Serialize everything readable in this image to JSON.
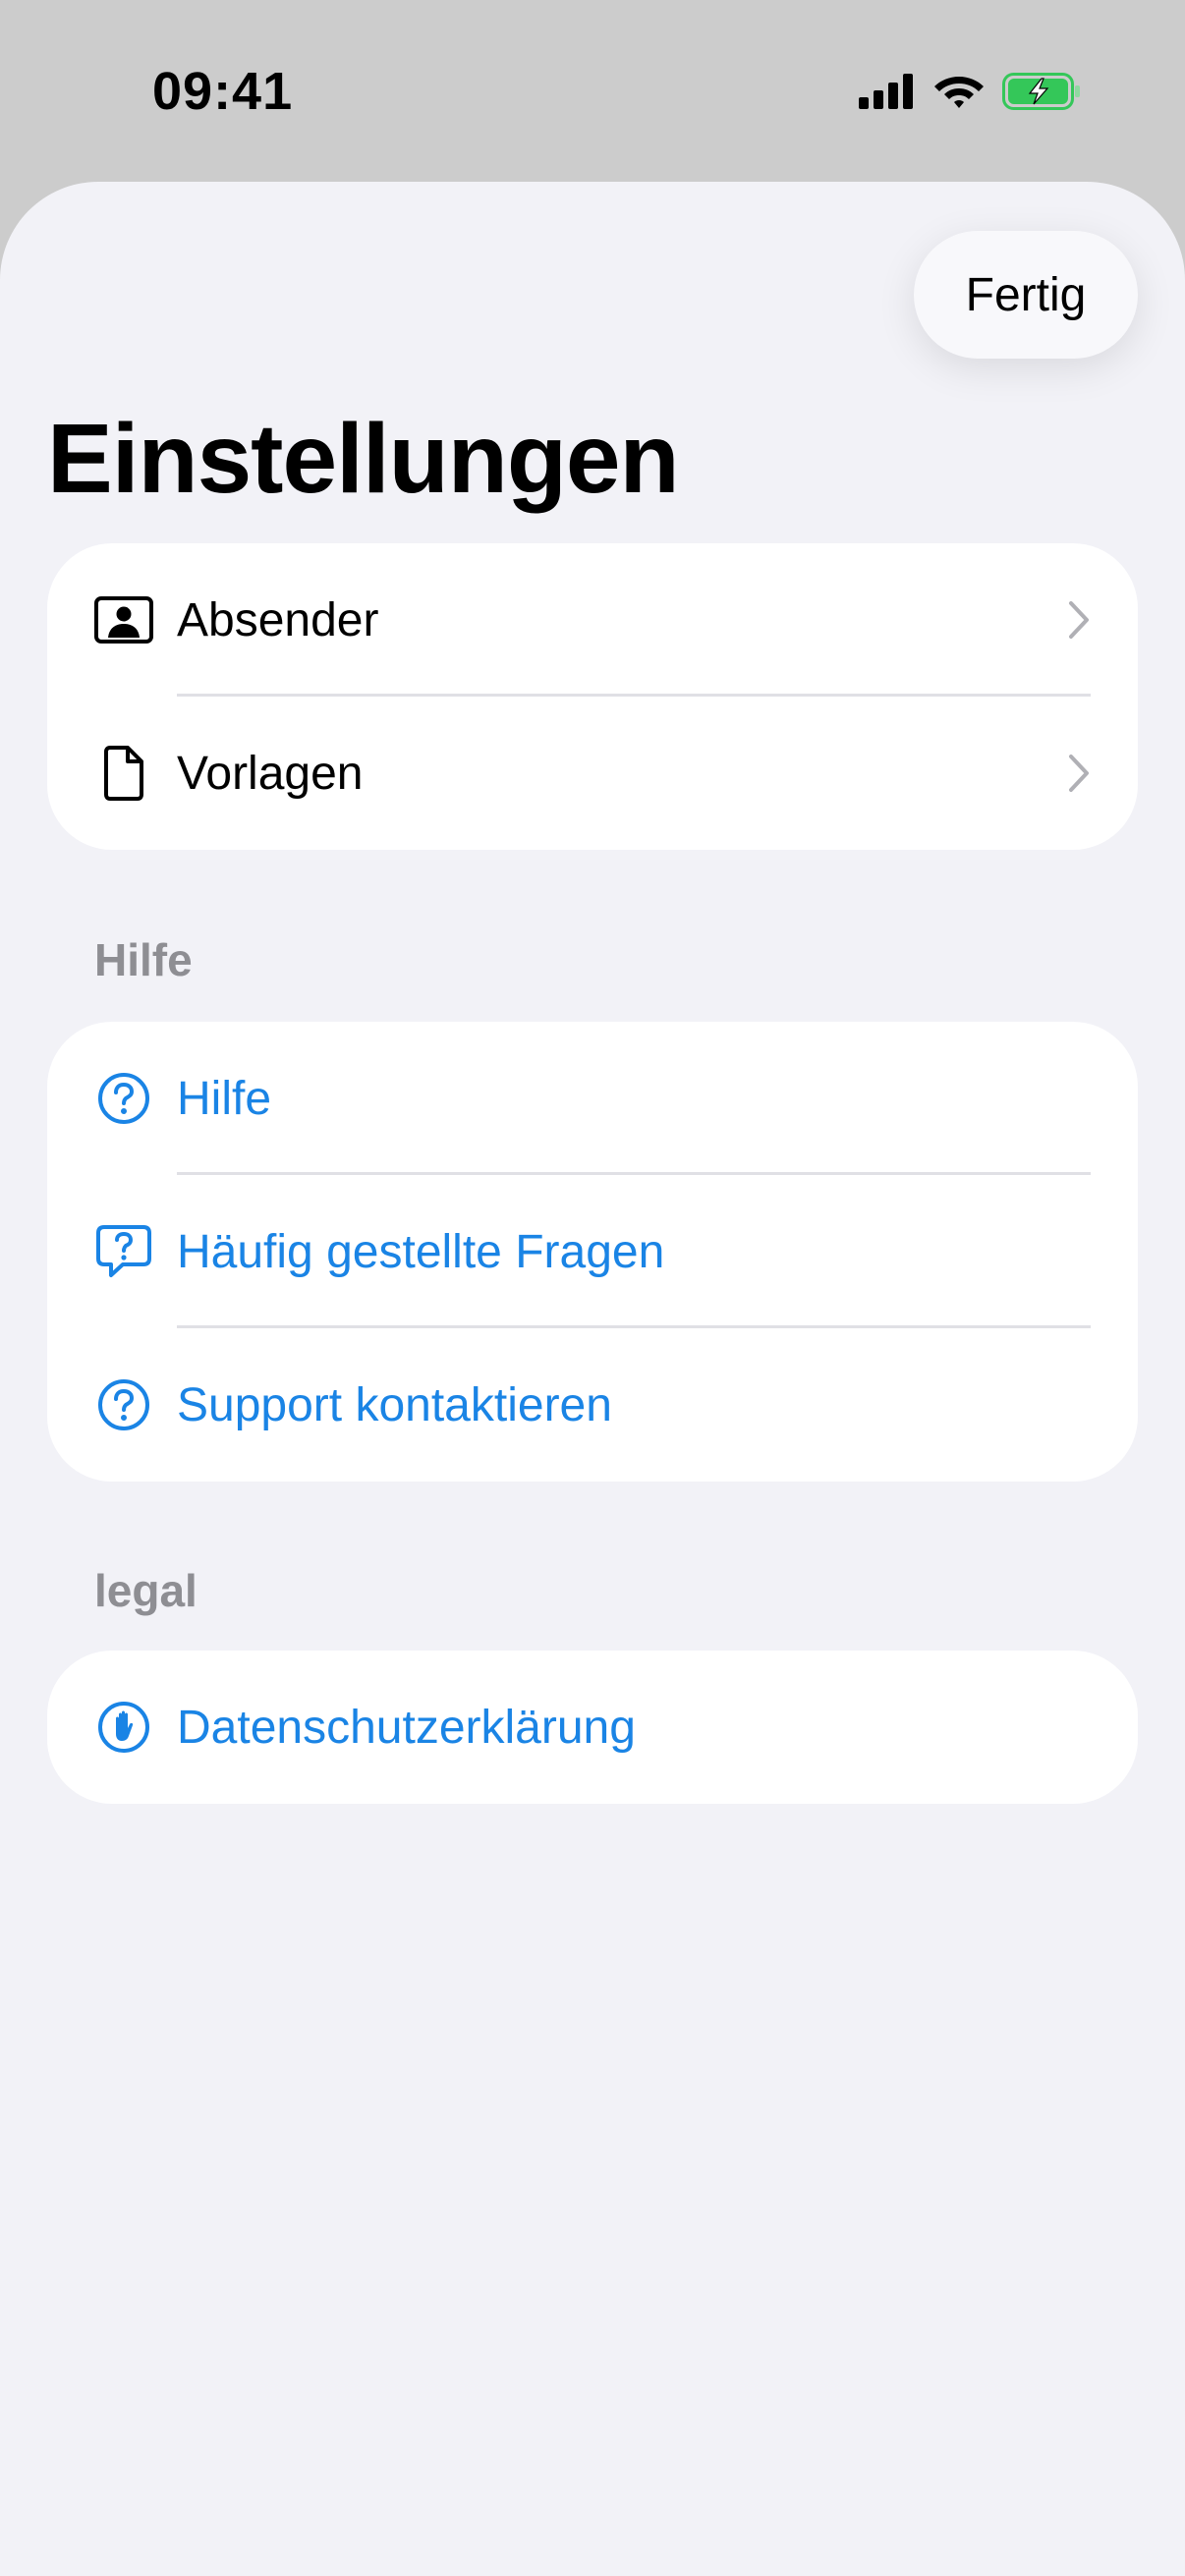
{
  "status_bar": {
    "time": "09:41"
  },
  "header": {
    "done_label": "Fertig",
    "title": "Einstellungen"
  },
  "general": {
    "items": [
      {
        "label": "Absender",
        "icon": "person-card-icon"
      },
      {
        "label": "Vorlagen",
        "icon": "document-icon"
      }
    ]
  },
  "help": {
    "header": "Hilfe",
    "items": [
      {
        "label": "Hilfe",
        "icon": "question-circle-icon"
      },
      {
        "label": "Häufig gestellte Fragen",
        "icon": "question-bubble-icon"
      },
      {
        "label": "Support kontaktieren",
        "icon": "question-circle-icon"
      }
    ]
  },
  "legal": {
    "header": "legal",
    "items": [
      {
        "label": "Datenschutzerklärung",
        "icon": "hand-raised-icon"
      }
    ]
  },
  "colors": {
    "accent": "#1a84e5",
    "sheet_background": "#f2f2f7",
    "status_background": "#cccccc",
    "battery": "#34c759"
  }
}
